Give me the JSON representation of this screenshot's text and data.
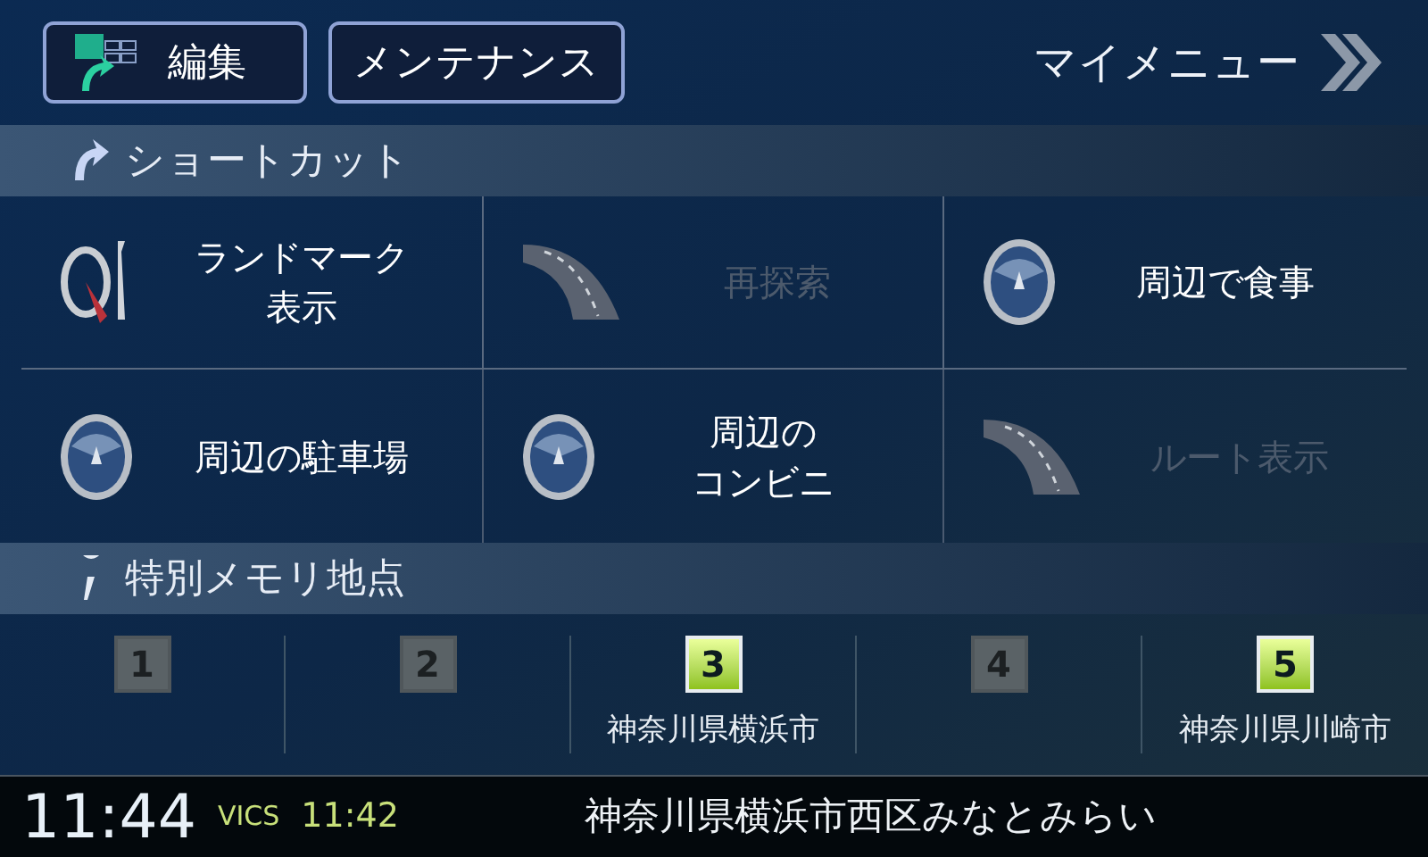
{
  "top_bar": {
    "edit_button": {
      "label": "編集"
    },
    "maintenance_button": {
      "label": "メンテナンス"
    },
    "my_menu": {
      "label": "マイメニュー"
    }
  },
  "shortcuts": {
    "title": "ショートカット",
    "items": [
      {
        "kind": "landmark",
        "lines": [
          "ランドマーク",
          "表示"
        ],
        "disabled": false
      },
      {
        "kind": "route",
        "lines": [
          "再探索"
        ],
        "disabled": true
      },
      {
        "kind": "lens",
        "lines": [
          "周辺で食事"
        ],
        "disabled": false
      },
      {
        "kind": "lens",
        "lines": [
          "周辺の駐車場"
        ],
        "disabled": false
      },
      {
        "kind": "lens",
        "lines": [
          "周辺の",
          "コンビニ"
        ],
        "disabled": false
      },
      {
        "kind": "route",
        "lines": [
          "ルート表示"
        ],
        "disabled": true
      }
    ]
  },
  "memory_points": {
    "title": "特別メモリ地点",
    "slots": [
      {
        "number": "1",
        "registered": false
      },
      {
        "number": "2",
        "registered": false
      },
      {
        "number": "3",
        "registered": true,
        "place": "神奈川県横浜市"
      },
      {
        "number": "4",
        "registered": false
      },
      {
        "number": "5",
        "registered": true,
        "place": "神奈川県川崎市"
      }
    ]
  },
  "status_bar": {
    "clock": "11:44",
    "vics_label": "VICS",
    "vics_time": "11:42",
    "location": "神奈川県横浜市西区みなとみらい"
  }
}
